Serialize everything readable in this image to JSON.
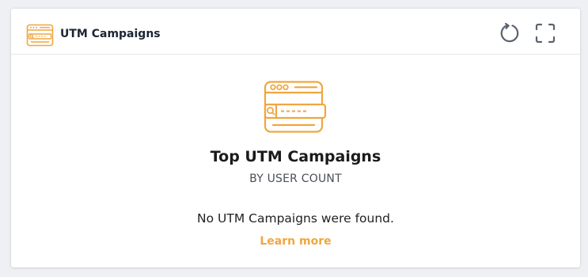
{
  "widget": {
    "title": "UTM Campaigns",
    "header_icon": "browser-search-icon",
    "actions": [
      {
        "name": "refresh",
        "icon": "refresh-icon"
      },
      {
        "name": "expand",
        "icon": "fullscreen-icon"
      }
    ]
  },
  "empty_state": {
    "icon": "browser-search-icon",
    "title": "Top UTM Campaigns",
    "subtitle": "BY USER COUNT",
    "message": "No UTM Campaigns were found.",
    "link_label": "Learn more"
  },
  "colors": {
    "accent": "#f0a640",
    "icon_gray": "#5b6270",
    "title_text": "#1c2434"
  }
}
